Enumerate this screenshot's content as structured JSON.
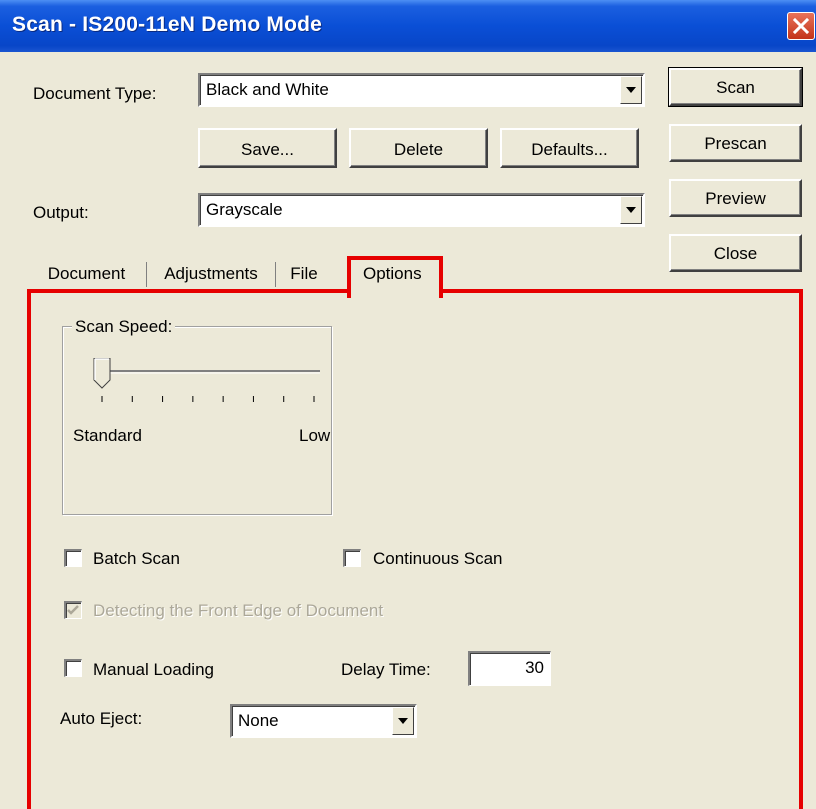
{
  "window": {
    "title": "Scan - IS200-11eN Demo Mode"
  },
  "document_type": {
    "label": "Document Type:",
    "value": "Black and White"
  },
  "preset_buttons": {
    "save": "Save...",
    "delete": "Delete",
    "defaults": "Defaults..."
  },
  "output": {
    "label": "Output:",
    "value": "Grayscale"
  },
  "side_buttons": {
    "scan": "Scan",
    "prescan": "Prescan",
    "preview": "Preview",
    "close": "Close"
  },
  "tabs": [
    {
      "label": "Document"
    },
    {
      "label": "Adjustments"
    },
    {
      "label": "File"
    },
    {
      "label": "Options",
      "selected": true
    }
  ],
  "scan_speed": {
    "group_label": "Scan Speed:",
    "min_label": "Standard",
    "max_label": "Low",
    "position": 0,
    "tick_count": 8
  },
  "batch_scan": {
    "label": "Batch Scan",
    "checked": false
  },
  "continuous_scan": {
    "label": "Continuous Scan",
    "checked": false
  },
  "front_edge": {
    "label": "Detecting the Front Edge of Document",
    "checked": true,
    "disabled": true
  },
  "manual_loading": {
    "label": "Manual Loading",
    "checked": false
  },
  "delay_time": {
    "label": "Delay Time:",
    "value": "30"
  },
  "auto_eject": {
    "label": "Auto Eject:",
    "value": "None"
  },
  "colors": {
    "titlebar": "#0a4fd6",
    "highlight": "#e60000",
    "face": "#ece9d8"
  }
}
